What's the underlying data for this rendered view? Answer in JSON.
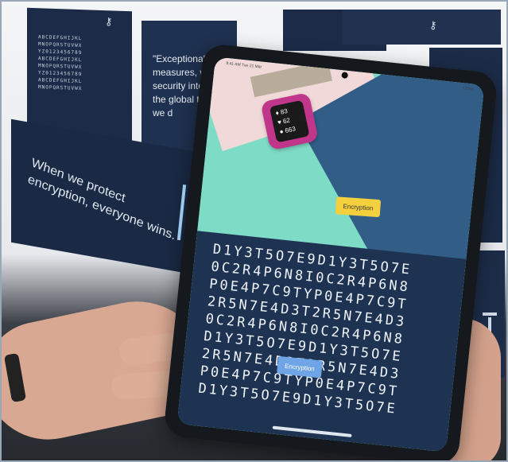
{
  "scene": {
    "wall": {
      "panel_grid_text": "ABCDEFGHIJKL\nMNOPQRSTUVWX\nYZ0123456789\nABCDEFGHIJKL\nMNOPQRSTUVWX\nYZ0123456789\nABCDEFGHIJKL\nMNOPQRSTUVWX",
      "quote_text": "\"Exceptional ac measures, we the security internet a the global the criti we d",
      "motto_text": "When we protect encryption, everyone wins."
    },
    "tablet": {
      "status_left": "9:41 AM  Tue 21 Mar",
      "status_right": "100%",
      "watch_readings": [
        "83",
        "62",
        "663"
      ],
      "top_button_label": "Encryption",
      "bottom_button_label": "Encryption",
      "cipher_lines": [
        "D1Y3T5O7E9D1Y3T5O7E",
        "0C2R4P6N8I0C2R4P6N8",
        "P0E4P7C9TYP0E4P7C9T",
        "2R5N7E4D3T2R5N7E4D3",
        "0C2R4P6N8I0C2R4P6N8",
        "D1Y3T5O7E9D1Y3T5O7E",
        "2R5N7E4D3T2R5N7E4D3",
        "P0E4P7C9TYP0E4P7C9T",
        "D1Y3T5O7E9D1Y3T5O7E"
      ]
    },
    "colors": {
      "panel_navy": "#1c2c48",
      "screen_mint": "#76d8c6",
      "watch_magenta": "#c0368a",
      "cipher_bg": "#1e3352",
      "button_yellow": "#f4d03f",
      "button_blue": "#6fa5e6"
    },
    "icons": [
      "key-icon",
      "key-icon",
      "barcode-icon"
    ]
  }
}
